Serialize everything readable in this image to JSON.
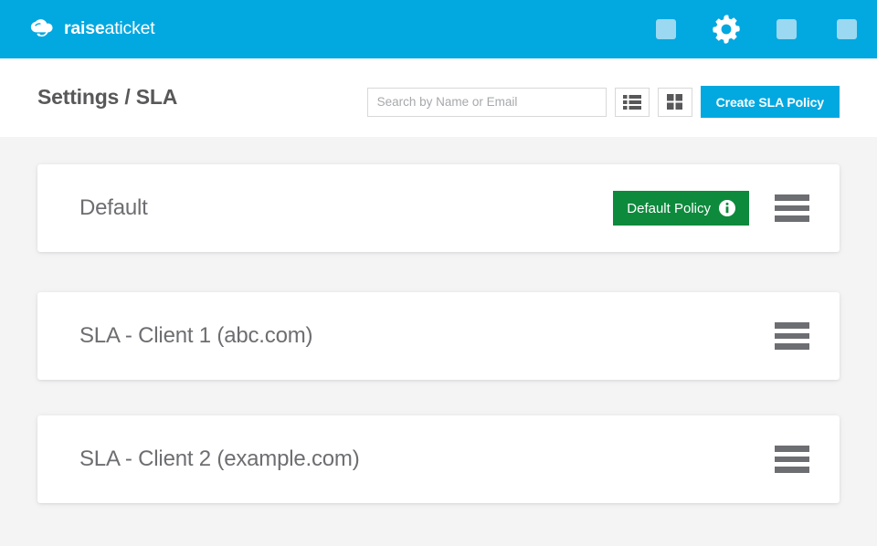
{
  "brand": {
    "name_bold": "raise",
    "name_light": "aticket",
    "logo_icon": "cloud-refresh-icon",
    "color": "#02a8e0"
  },
  "topbar": {
    "background": "#02a8e0",
    "items": [
      {
        "name": "nav-placeholder-1",
        "icon": "square-placeholder-icon",
        "active": false
      },
      {
        "name": "nav-settings",
        "icon": "gear-icon",
        "active": true
      },
      {
        "name": "nav-placeholder-2",
        "icon": "square-placeholder-icon",
        "active": false
      },
      {
        "name": "nav-placeholder-3",
        "icon": "square-placeholder-icon",
        "active": false
      }
    ],
    "placeholder_color": "#9ad9f1",
    "active_icon_color": "#ffffff"
  },
  "header": {
    "title": "Settings / SLA"
  },
  "search": {
    "placeholder": "Search by Name or Email",
    "value": ""
  },
  "view_toggle": {
    "list_icon": "list-view-icon",
    "grid_icon": "grid-view-icon",
    "selected": "list"
  },
  "actions": {
    "create_label": "Create SLA Policy",
    "create_color": "#02a8e0"
  },
  "policies": [
    {
      "name": "Default",
      "badge": "Default Policy",
      "badge_icon": "info-icon",
      "badge_color": "#0e8a3d",
      "has_badge": true,
      "menu_icon": "hamburger-menu-icon"
    },
    {
      "name": "SLA - Client 1 (abc.com)",
      "badge": "",
      "has_badge": false,
      "menu_icon": "hamburger-menu-icon"
    },
    {
      "name": "SLA - Client 2 (example.com)",
      "badge": "",
      "has_badge": false,
      "menu_icon": "hamburger-menu-icon"
    }
  ]
}
